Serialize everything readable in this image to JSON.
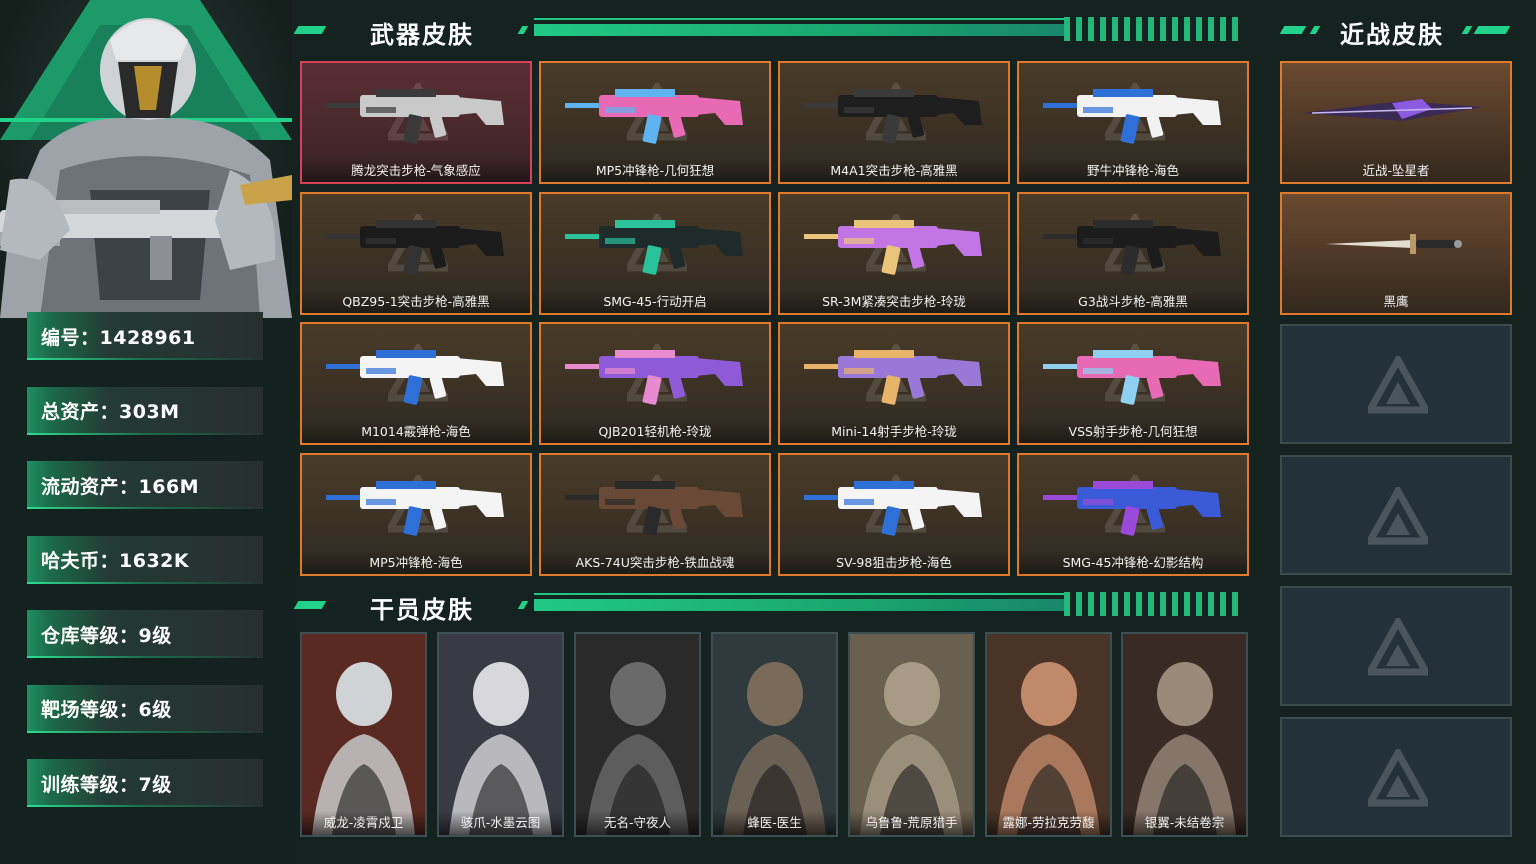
{
  "profile": {
    "stats": [
      {
        "label": "编号：1428961"
      },
      {
        "label": "总资产：303M"
      },
      {
        "label": "流动资产：166M"
      },
      {
        "label": "哈夫币：1632K"
      },
      {
        "label": "仓库等级：9级"
      },
      {
        "label": "靶场等级：6级"
      },
      {
        "label": "训练等级：7级"
      }
    ]
  },
  "sections": {
    "weapons_title": "武器皮肤",
    "melee_title": "近战皮肤",
    "operators_title": "干员皮肤"
  },
  "weapons": [
    {
      "name": "腾龙突击步枪-气象感应",
      "rarity": "red"
    },
    {
      "name": "MP5冲锋枪-几何狂想",
      "rarity": "orange"
    },
    {
      "name": "M4A1突击步枪-高雅黑",
      "rarity": "orange"
    },
    {
      "name": "野牛冲锋枪-海色",
      "rarity": "orange"
    },
    {
      "name": "QBZ95-1突击步枪-高雅黑",
      "rarity": "orange"
    },
    {
      "name": "SMG-45-行动开启",
      "rarity": "orange"
    },
    {
      "name": "SR-3M紧凑突击步枪-玲珑",
      "rarity": "orange"
    },
    {
      "name": "G3战斗步枪-高雅黑",
      "rarity": "orange"
    },
    {
      "name": "M1014霰弹枪-海色",
      "rarity": "orange"
    },
    {
      "name": "QJB201轻机枪-玲珑",
      "rarity": "orange"
    },
    {
      "name": "Mini-14射手步枪-玲珑",
      "rarity": "orange"
    },
    {
      "name": "VSS射手步枪-几何狂想",
      "rarity": "orange"
    },
    {
      "name": "MP5冲锋枪-海色",
      "rarity": "orange"
    },
    {
      "name": "AKS-74U突击步枪-铁血战魂",
      "rarity": "orange"
    },
    {
      "name": "SV-98狙击步枪-海色",
      "rarity": "orange"
    },
    {
      "name": "SMG-45冲锋枪-幻影结构",
      "rarity": "orange"
    }
  ],
  "melee": [
    {
      "name": "近战-坠星者"
    },
    {
      "name": "黑鹰"
    }
  ],
  "melee_empty_slots": 4,
  "operators": [
    {
      "name": "威龙-凌霄戍卫"
    },
    {
      "name": "骇爪-水墨云图"
    },
    {
      "name": "无名-守夜人"
    },
    {
      "name": "蜂医-医生"
    },
    {
      "name": "乌鲁鲁-荒原猎手"
    },
    {
      "name": "露娜-劳拉克劳馥"
    },
    {
      "name": "银翼-未结卷宗"
    }
  ],
  "colors": {
    "accent_green": "#23d28a",
    "rare_orange": "#e07a2a",
    "rare_red": "#d6405a",
    "background": "#152320"
  }
}
